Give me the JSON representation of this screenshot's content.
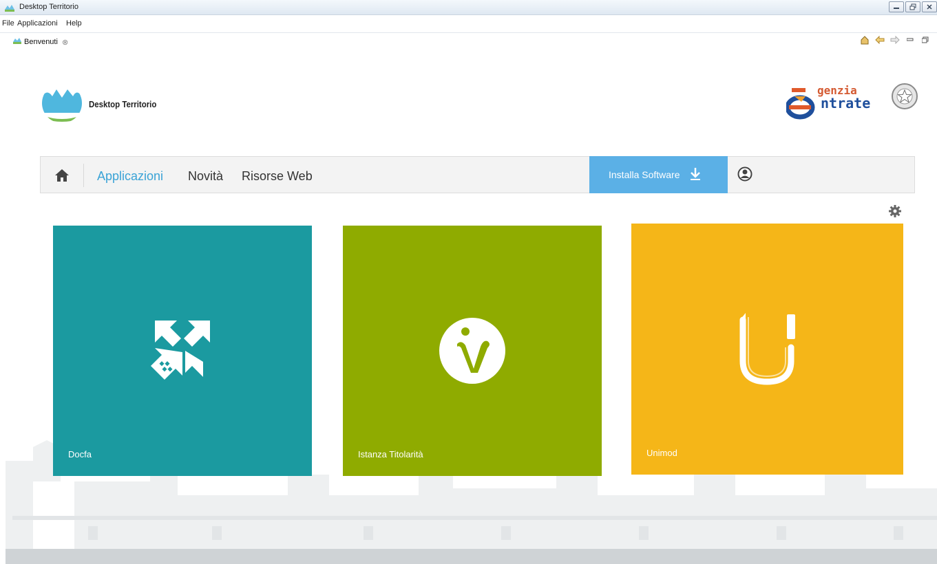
{
  "window": {
    "title": "Desktop Territorio"
  },
  "menubar": {
    "items": [
      "File",
      "Applicazioni",
      "Help"
    ]
  },
  "tab": {
    "label": "Benvenuti",
    "close_glyph": "⊗"
  },
  "header": {
    "brand_name": "Desktop Territorio",
    "agency_word_1": "genzia",
    "agency_word_2": "ntrate"
  },
  "nav": {
    "links": [
      "Applicazioni",
      "Novità",
      "Risorse Web"
    ],
    "active": "Applicazioni",
    "install_label": "Installa Software"
  },
  "tiles": [
    {
      "label": "Docfa",
      "color": "#1b9aa0",
      "icon": "docfa-arrows-icon"
    },
    {
      "label": "Istanza Titolarità",
      "color": "#8fab00",
      "icon": "v-circle-icon"
    },
    {
      "label": "Unimod",
      "color": "#f5b618",
      "icon": "u-pencil-icon"
    }
  ],
  "colors": {
    "accent": "#3aa3d6",
    "install_button": "#5bb0e6"
  }
}
